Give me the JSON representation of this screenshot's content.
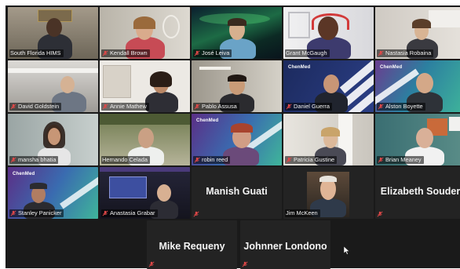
{
  "participants": [
    {
      "name": "South Florida HIMS"
    },
    {
      "name": "Kendall Brown"
    },
    {
      "name": "José Leiva"
    },
    {
      "name": "Grant McGaugh"
    },
    {
      "name": "Nastasia Robaina"
    },
    {
      "name": "David Goldstein"
    },
    {
      "name": "Annie Mathew"
    },
    {
      "name": "Pablo Assusa"
    },
    {
      "name": "Daniel Guerra"
    },
    {
      "name": "Alston Boyette"
    },
    {
      "name": "mansha bhatia"
    },
    {
      "name": "Hernando Celada"
    },
    {
      "name": "robin reed"
    },
    {
      "name": "Patricia Gustine"
    },
    {
      "name": "Brian Meaney"
    },
    {
      "name": "Stanley Panicker"
    },
    {
      "name": "Anastasia Grabar"
    },
    {
      "name": "Manish Guati"
    },
    {
      "name": "Jim McKeen"
    },
    {
      "name": "Elizabeth Souder"
    }
  ],
  "bottom_participants": [
    {
      "name": "Mike Requeny"
    },
    {
      "name": "Johnner Londono"
    }
  ],
  "brand": {
    "logo_text": "ChenMed"
  },
  "colors": {
    "active_speaker_border": "#c8d83a",
    "muted_icon": "#e04848",
    "tile_dark": "#232323"
  },
  "icons": {
    "muted": "muted-microphone-icon",
    "cursor": "mouse-pointer-icon"
  }
}
